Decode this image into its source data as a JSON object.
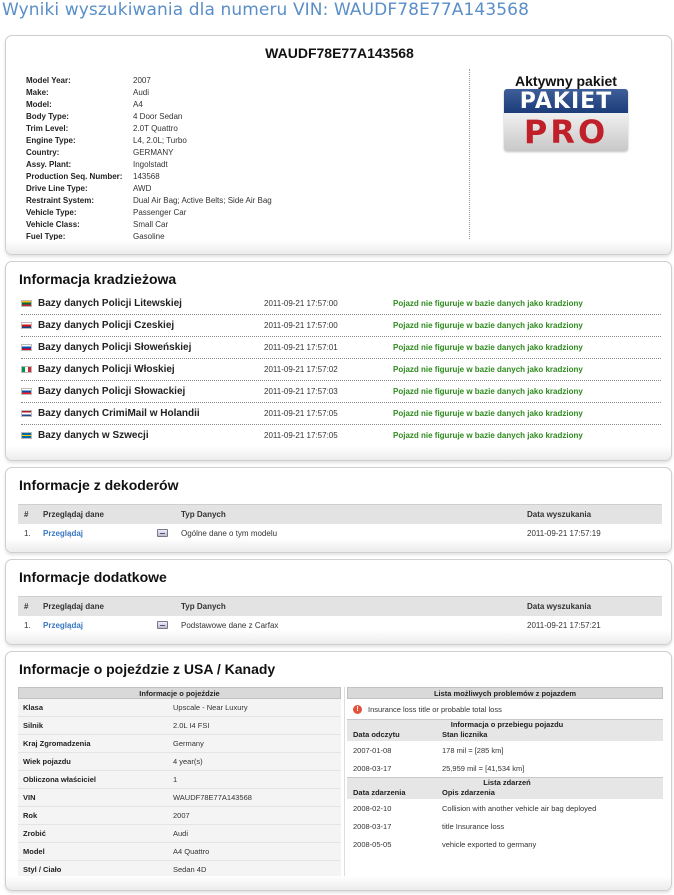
{
  "page": {
    "title": "Wyniki wyszukiwania dla numeru VIN: WAUDF78E77A143568"
  },
  "vin_panel": {
    "vin": "WAUDF78E77A143568",
    "specs": [
      {
        "label": "Model Year:",
        "value": "2007"
      },
      {
        "label": "Make:",
        "value": "Audi"
      },
      {
        "label": "Model:",
        "value": "A4"
      },
      {
        "label": "Body Type:",
        "value": "4 Door Sedan"
      },
      {
        "label": "Trim Level:",
        "value": "2.0T Quattro"
      },
      {
        "label": "Engine Type:",
        "value": "L4, 2.0L; Turbo"
      },
      {
        "label": "Country:",
        "value": "GERMANY"
      },
      {
        "label": "Assy. Plant:",
        "value": "Ingolstadt"
      },
      {
        "label": "Production Seq. Number:",
        "value": "143568"
      },
      {
        "label": "Drive Line Type:",
        "value": "AWD"
      },
      {
        "label": "Restraint System:",
        "value": "Dual Air Bag; Active Belts; Side Air Bag"
      },
      {
        "label": "Vehicle Type:",
        "value": "Passenger Car"
      },
      {
        "label": "Vehicle Class:",
        "value": "Small Car"
      },
      {
        "label": "Fuel Type:",
        "value": "Gasoline"
      }
    ],
    "package_title": "Aktywny pakiet",
    "logo": {
      "top": "PAKIET",
      "bottom": "PRO"
    }
  },
  "theft": {
    "title": "Informacja kradzieżowa",
    "rows": [
      {
        "db": "Bazy danych Policji Litewskiej",
        "date": "2011-09-21 17:57:00",
        "status": "Pojazd nie figuruje w bazie danych jako kradziony",
        "flag": "lithuania-flag-icon",
        "colors": [
          "#fdb913",
          "#006a44",
          "#c1272d"
        ]
      },
      {
        "db": "Bazy danych Policji Czeskiej",
        "date": "2011-09-21 17:57:00",
        "status": "Pojazd nie figuruje w bazie danych jako kradziony",
        "flag": "czech-flag-icon",
        "colors": [
          "#ffffff",
          "#d7141a",
          "#11457e"
        ]
      },
      {
        "db": "Bazy danych Policji Słoweńskiej",
        "date": "2011-09-21 17:57:01",
        "status": "Pojazd nie figuruje w bazie danych jako kradziony",
        "flag": "slovenia-flag-icon",
        "colors": [
          "#ffffff",
          "#0052b4",
          "#d80027"
        ]
      },
      {
        "db": "Bazy danych Policji Włoskiej",
        "date": "2011-09-21 17:57:02",
        "status": "Pojazd nie figuruje w bazie danych jako kradziony",
        "flag": "italy-flag-icon",
        "colors": [
          "#009246",
          "#ffffff",
          "#ce2b37"
        ]
      },
      {
        "db": "Bazy danych Policji Słowackiej",
        "date": "2011-09-21 17:57:03",
        "status": "Pojazd nie figuruje w bazie danych jako kradziony",
        "flag": "slovakia-flag-icon",
        "colors": [
          "#ffffff",
          "#0b4ea2",
          "#ee1c25"
        ]
      },
      {
        "db": "Bazy danych CrimiMail w Holandii",
        "date": "2011-09-21 17:57:05",
        "status": "Pojazd nie figuruje w bazie danych jako kradziony",
        "flag": "netherlands-flag-icon",
        "colors": [
          "#ae1c28",
          "#ffffff",
          "#21468b"
        ]
      },
      {
        "db": "Bazy danych w Szwecji",
        "date": "2011-09-21 17:57:05",
        "status": "Pojazd nie figuruje w bazie danych jako kradziony",
        "flag": "sweden-flag-icon",
        "colors": [
          "#006aa7",
          "#fecc00",
          "#006aa7"
        ]
      }
    ]
  },
  "decoders": {
    "title": "Informacje z dekoderów",
    "headers": {
      "num": "#",
      "browse": "Przeglądaj dane",
      "type": "Typ Danych",
      "date": "Data wyszukania"
    },
    "rows": [
      {
        "num": "1.",
        "browse": "Przeglądaj",
        "type": "Ogólne dane o tym modelu",
        "date": "2011-09-21 17:57:19"
      }
    ]
  },
  "additional": {
    "title": "Informacje dodatkowe",
    "headers": {
      "num": "#",
      "browse": "Przeglądaj dane",
      "type": "Typ Danych",
      "date": "Data wyszukania"
    },
    "rows": [
      {
        "num": "1.",
        "browse": "Przeglądaj",
        "type": "Podstawowe dane z Carfax",
        "date": "2011-09-21 17:57:21"
      }
    ]
  },
  "usa": {
    "title": "Informacje o pojeździe z USA / Kanady",
    "vehicle_info_title": "Informacje o pojeździe",
    "vehicle_info": [
      {
        "label": "Klasa",
        "value": "Upscale - Near Luxury"
      },
      {
        "label": "Silnik",
        "value": "2.0L I4 FSI"
      },
      {
        "label": "Kraj Zgromadzenia",
        "value": "Germany"
      },
      {
        "label": "Wiek pojazdu",
        "value": "4 year(s)"
      },
      {
        "label": "Obliczona właściciel",
        "value": "1"
      },
      {
        "label": "VIN",
        "value": "WAUDF78E77A143568"
      },
      {
        "label": "Rok",
        "value": "2007"
      },
      {
        "label": "Zrobić",
        "value": "Audi"
      },
      {
        "label": "Model",
        "value": "A4 Quattro"
      },
      {
        "label": "Styl / Ciało",
        "value": "Sedan 4D"
      }
    ],
    "problems_title": "Lista możliwych problemów z pojazdem",
    "problems": [
      "Insurance loss title or probable total loss"
    ],
    "mileage_title": "Informacja o przebiegu pojazdu",
    "mileage_headers": {
      "date": "Data odczytu",
      "reading": "Stan licznika"
    },
    "mileage": [
      {
        "date": "2007-01-08",
        "reading": "178 mil = [285 km]"
      },
      {
        "date": "2008-03-17",
        "reading": "25,959 mil = [41,534 km]"
      }
    ],
    "events_title": "Lista zdarzeń",
    "events_headers": {
      "date": "Data zdarzenia",
      "desc": "Opis zdarzenia"
    },
    "events": [
      {
        "date": "2008-02-10",
        "desc": "Collision with another vehicle air bag deployed"
      },
      {
        "date": "2008-03-17",
        "desc": "title Insurance loss"
      },
      {
        "date": "2008-05-05",
        "desc": "vehicle exported to germany"
      }
    ]
  }
}
